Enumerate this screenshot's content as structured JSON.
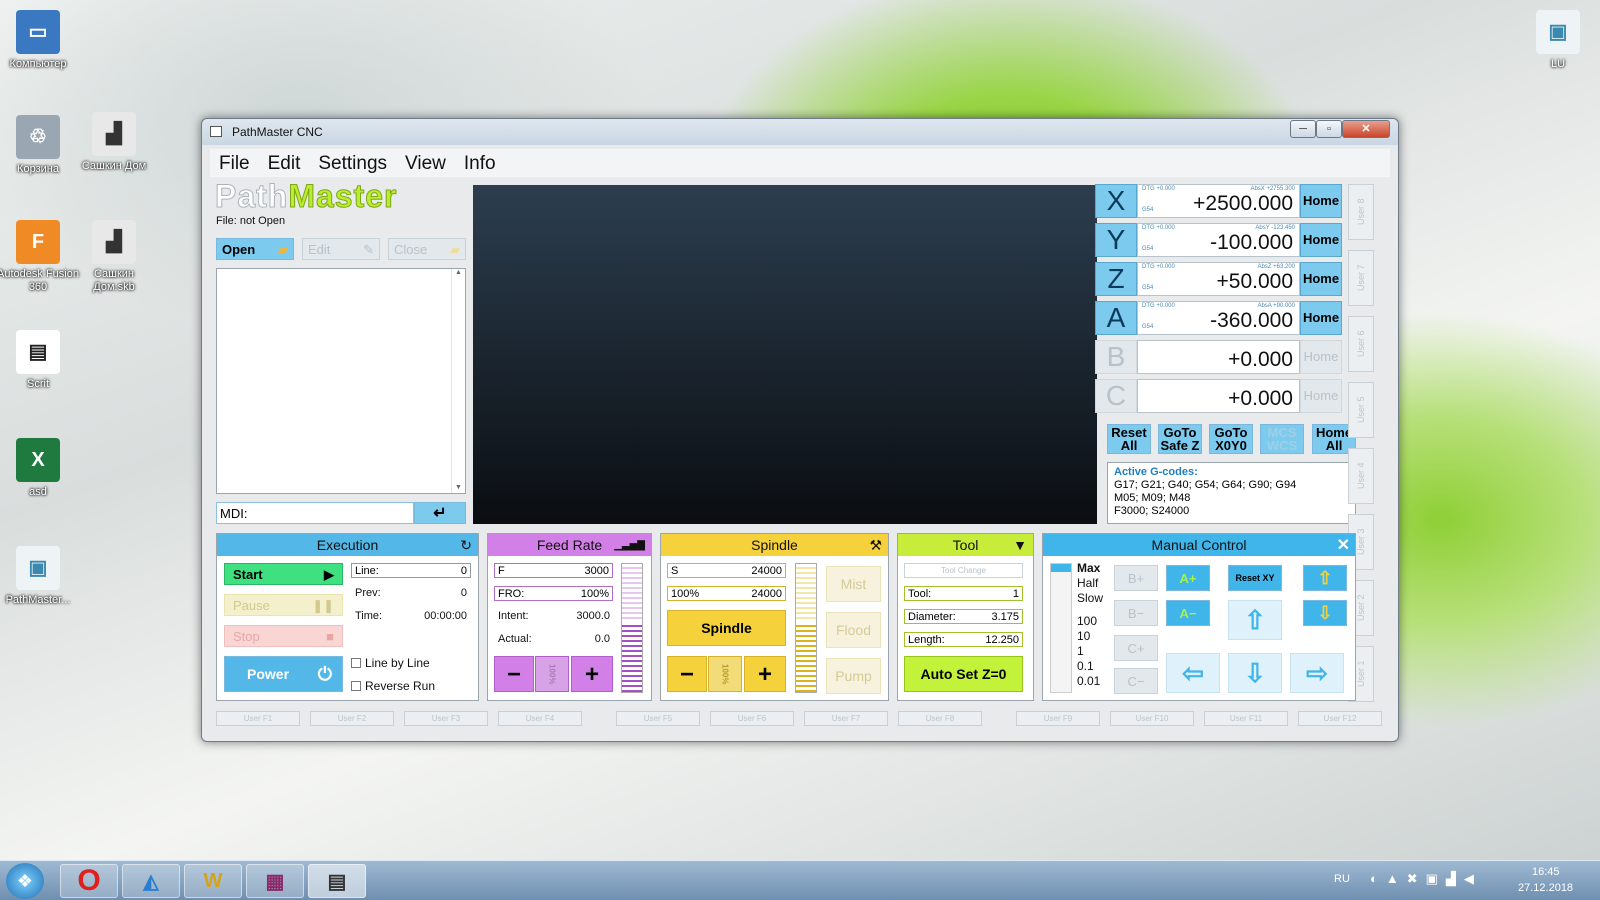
{
  "desktop": {
    "icons": [
      {
        "label": "Компьютер",
        "glyph": "▭"
      },
      {
        "label": "Корзина",
        "glyph": "♲"
      },
      {
        "label": "Сашкин Дом",
        "glyph": "▟"
      },
      {
        "label": "Autodesk Fusion 360",
        "glyph": "F"
      },
      {
        "label": "Сашкин Дом.skb",
        "glyph": "▟"
      },
      {
        "label": "Scrit",
        "glyph": "▤"
      },
      {
        "label": "asd",
        "glyph": "X"
      },
      {
        "label": "PathMaster...",
        "glyph": "▣"
      },
      {
        "label": "LU",
        "glyph": "▣"
      }
    ]
  },
  "window": {
    "title": "PathMaster CNC",
    "min": "─",
    "max": "▫",
    "close": "✕"
  },
  "menu": [
    "File",
    "Edit",
    "Settings",
    "View",
    "Info"
  ],
  "logo": {
    "a": "Path",
    "b": "Master"
  },
  "file_status": "File: not Open",
  "file_buttons": {
    "open": "Open",
    "edit": "Edit",
    "close": "Close"
  },
  "mdi": {
    "label": "MDI:",
    "enter": "↵"
  },
  "axes": [
    {
      "name": "X",
      "value": "+2500.000",
      "home": "Home",
      "dtg": "DTG +0.000",
      "abs": "AbsX +2755.300",
      "wcs": "G54",
      "enabled": true
    },
    {
      "name": "Y",
      "value": "-100.000",
      "home": "Home",
      "dtg": "DTG +0.000",
      "abs": "AbsY -123.450",
      "wcs": "G54",
      "enabled": true
    },
    {
      "name": "Z",
      "value": "+50.000",
      "home": "Home",
      "dtg": "DTG +0.000",
      "abs": "AbsZ +63.200",
      "wcs": "G54",
      "enabled": true
    },
    {
      "name": "A",
      "value": "-360.000",
      "home": "Home",
      "dtg": "DTG +0.000",
      "abs": "AbsA +90.000",
      "wcs": "G54",
      "enabled": true
    },
    {
      "name": "B",
      "value": "+0.000",
      "home": "Home",
      "dtg": "",
      "abs": "",
      "wcs": "",
      "enabled": false
    },
    {
      "name": "C",
      "value": "+0.000",
      "home": "Home",
      "dtg": "",
      "abs": "",
      "wcs": "",
      "enabled": false
    }
  ],
  "axis_buttons": [
    "Reset All",
    "GoTo Safe Z",
    "GoTo X0Y0",
    "MCS WCS",
    "Home All"
  ],
  "gcodes": {
    "title": "Active G-codes:",
    "lines": [
      "G17; G21; G40; G54; G64; G90; G94",
      "M05; M09; M48",
      "F3000; S24000"
    ]
  },
  "user_tabs": [
    "User 8",
    "User 7",
    "User 6",
    "User 5",
    "User 4",
    "User 3",
    "User 2",
    "User 1"
  ],
  "execution": {
    "title": "Execution",
    "start": "Start",
    "pause": "Pause",
    "stop": "Stop",
    "power": "Power",
    "line_label": "Line:",
    "line_val": "0",
    "prev_label": "Prev:",
    "prev_val": "0",
    "time_label": "Time:",
    "time_val": "00:00:00",
    "line_by_line": "Line by Line",
    "reverse_run": "Reverse Run"
  },
  "feed": {
    "title": "Feed Rate",
    "f_label": "F",
    "f_val": "3000",
    "fro_label": "FRO:",
    "fro_val": "100%",
    "intent_label": "Intent:",
    "intent_val": "3000.0",
    "actual_label": "Actual:",
    "actual_val": "0.0",
    "minus": "−",
    "mid": "100%",
    "plus": "+"
  },
  "spindle": {
    "title": "Spindle",
    "s_label": "S",
    "s_val": "24000",
    "pct": "100%",
    "pct_val": "24000",
    "btn": "Spindle",
    "mist": "Mist",
    "flood": "Flood",
    "pump": "Pump",
    "minus": "−",
    "mid": "100%",
    "plus": "+"
  },
  "tool": {
    "title": "Tool",
    "change": "Tool Change",
    "tool_label": "Tool:",
    "tool_val": "1",
    "dia_label": "Diameter:",
    "dia_val": "3.175",
    "len_label": "Length:",
    "len_val": "12.250",
    "auto": "Auto Set Z=0"
  },
  "manual": {
    "title": "Manual Control",
    "close": "✕",
    "speeds": [
      "Max",
      "Half",
      "Slow",
      "100",
      "10",
      "1",
      "0.1",
      "0.01"
    ],
    "b_plus": "B+",
    "b_minus": "B−",
    "c_plus": "C+",
    "c_minus": "C−",
    "a_plus": "A+",
    "a_minus": "A−",
    "reset_xy": "Reset XY",
    "z_up": "Z",
    "z_down": "Z",
    "y_up": "Y",
    "y_down": "Y",
    "x_left": "X",
    "x_right": "X"
  },
  "fkeys": [
    "User F1",
    "User F2",
    "User F3",
    "User F4",
    "User F5",
    "User F6",
    "User F7",
    "User F8",
    "User F9",
    "User F10",
    "User F11",
    "User F12"
  ],
  "taskbar": {
    "lang": "RU",
    "time": "16:45",
    "date": "27.12.2018"
  },
  "colors": {
    "accent": "#7ccaee",
    "execution": "#53b8e8",
    "feed": "#d37fe8",
    "spindle": "#f5d23c",
    "tool": "#c8ec3a",
    "manual": "#3fb5ea",
    "start": "#3ee07f",
    "power": "#53b8e8",
    "auto": "#c2f23a"
  }
}
